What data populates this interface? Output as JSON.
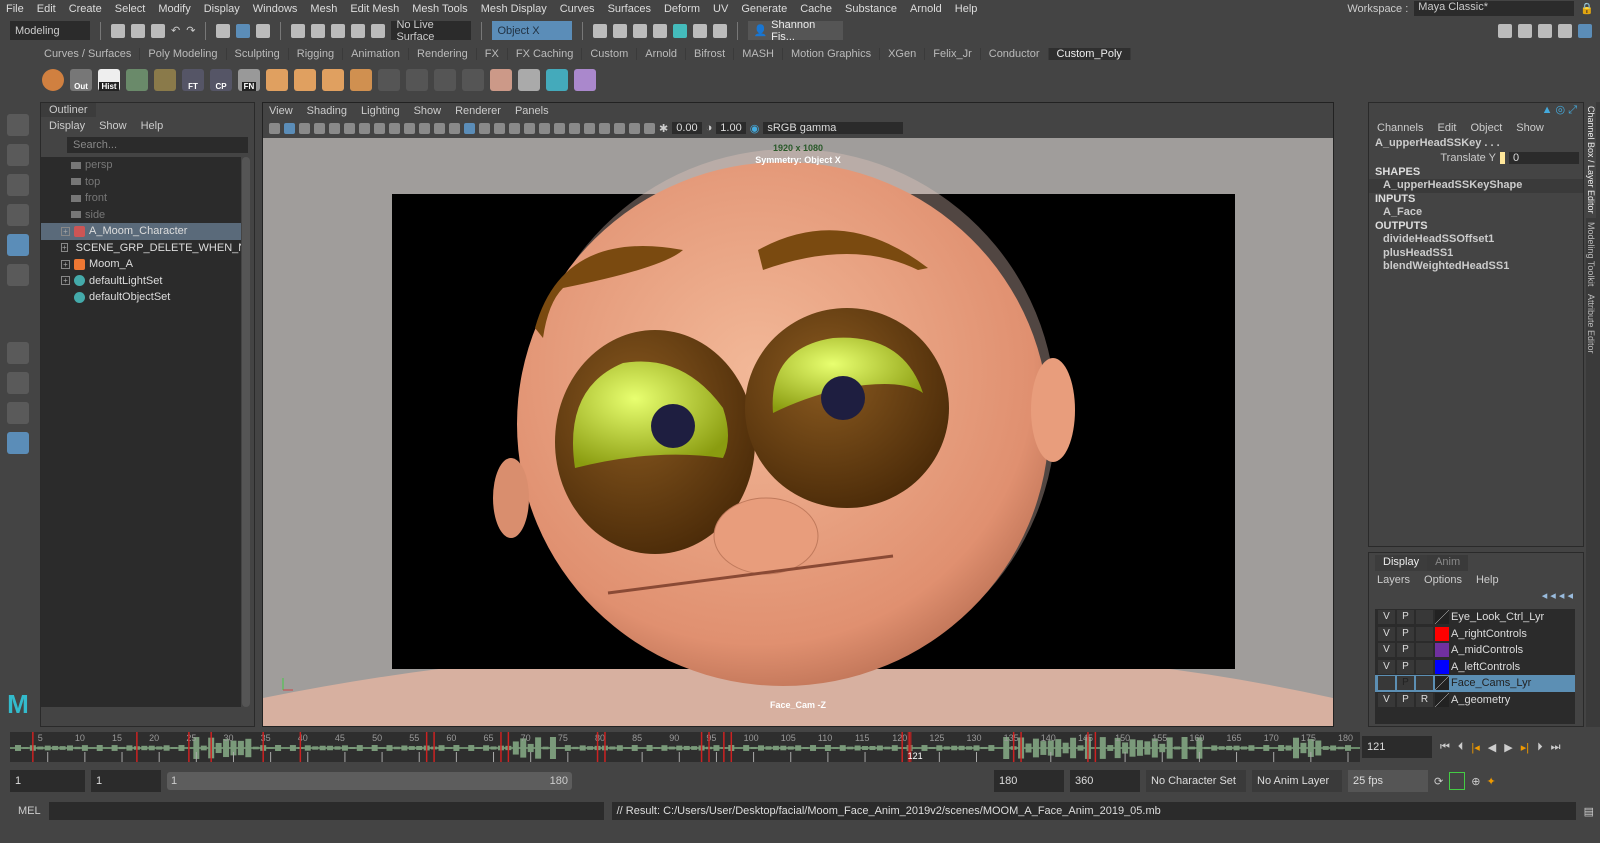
{
  "menu": [
    "File",
    "Edit",
    "Create",
    "Select",
    "Modify",
    "Display",
    "Windows",
    "Mesh",
    "Edit Mesh",
    "Mesh Tools",
    "Mesh Display",
    "Curves",
    "Surfaces",
    "Deform",
    "UV",
    "Generate",
    "Cache",
    "Substance",
    "Arnold",
    "Help"
  ],
  "workspace": {
    "label": "Workspace :",
    "value": "Maya Classic*"
  },
  "status": {
    "mode": "Modeling",
    "live_surface": "No Live Surface",
    "symmetry": "Object X",
    "user": "Shannon Fis..."
  },
  "shelf_tabs": [
    "Curves / Surfaces",
    "Poly Modeling",
    "Sculpting",
    "Rigging",
    "Animation",
    "Rendering",
    "FX",
    "FX Caching",
    "Custom",
    "Arnold",
    "Bifrost",
    "MASH",
    "Motion Graphics",
    "XGen",
    "Felix_Jr",
    "Conductor",
    "Custom_Poly"
  ],
  "shelf_labels": {
    "out": "Out",
    "hist": "Hist",
    "ft": "FT",
    "cp": "CP",
    "fn": "FN"
  },
  "outliner": {
    "title": "Outliner",
    "menu": [
      "Display",
      "Show",
      "Help"
    ],
    "search_placeholder": "Search...",
    "cameras": [
      "persp",
      "top",
      "front",
      "side"
    ],
    "items": [
      "A_Moom_Character",
      "SCENE_GRP_DELETE_WHEN_NECESSA",
      "Moom_A",
      "defaultLightSet",
      "defaultObjectSet"
    ]
  },
  "viewport": {
    "menu": [
      "View",
      "Shading",
      "Lighting",
      "Show",
      "Renderer",
      "Panels"
    ],
    "exposure": "0.00",
    "gamma": "1.00",
    "color_space": "sRGB gamma",
    "resolution": "1920 x 1080",
    "symmetry": "Symmetry: Object X",
    "camera": "Face_Cam -Z"
  },
  "channel_box": {
    "menu": [
      "Channels",
      "Edit",
      "Object",
      "Show"
    ],
    "node": "A_upperHeadSSKey . . .",
    "attr_label": "Translate Y",
    "attr_value": "0",
    "shapes_hdr": "SHAPES",
    "shape": "A_upperHeadSSKeyShape",
    "inputs_hdr": "INPUTS",
    "input": "A_Face",
    "outputs_hdr": "OUTPUTS",
    "outputs": [
      "divideHeadSSOffset1",
      "plusHeadSS1",
      "blendWeightedHeadSS1"
    ]
  },
  "layer_editor": {
    "tabs": [
      "Display",
      "Anim"
    ],
    "menu": [
      "Layers",
      "Options",
      "Help"
    ],
    "layers": [
      {
        "v": "V",
        "p": "P",
        "r": "",
        "name": "Eye_Look_Ctrl_Lyr",
        "color": ""
      },
      {
        "v": "V",
        "p": "P",
        "r": "",
        "name": "A_rightControls",
        "color": "#ff0000"
      },
      {
        "v": "V",
        "p": "P",
        "r": "",
        "name": "A_midControls",
        "color": "#7030a0"
      },
      {
        "v": "V",
        "p": "P",
        "r": "",
        "name": "A_leftControls",
        "color": "#0000ff"
      },
      {
        "v": "",
        "p": "P",
        "r": "",
        "name": "Face_Cams_Lyr",
        "color": ""
      },
      {
        "v": "V",
        "p": "P",
        "r": "R",
        "name": "A_geometry",
        "color": ""
      }
    ]
  },
  "side_tabs": [
    "Channel Box / Layer Editor",
    "Modeling Toolkit",
    "Attribute Editor"
  ],
  "timeline": {
    "start": 1,
    "end": 180,
    "current": 121,
    "current_label": "121",
    "keys": [
      3,
      17,
      24,
      27,
      34,
      39,
      56,
      57,
      66,
      67,
      79,
      80,
      93,
      94,
      96,
      97,
      120,
      121,
      135,
      136,
      145,
      146
    ],
    "labels": [
      "5",
      "10",
      "15",
      "20",
      "25",
      "30",
      "35",
      "40",
      "45",
      "50",
      "55",
      "60",
      "65",
      "70",
      "75",
      "80",
      "85",
      "90",
      "95",
      "100",
      "105",
      "110",
      "115",
      "120",
      "125",
      "130",
      "135",
      "140",
      "145",
      "150",
      "155",
      "160",
      "165",
      "170",
      "175",
      "180"
    ]
  },
  "current_frame_field": "121",
  "range": {
    "start": "1",
    "inner_start": "1",
    "slider_start": "1",
    "slider_end": "180",
    "end": "180",
    "outer_end": "360",
    "char_set": "No Character Set",
    "anim_layer": "No Anim Layer",
    "fps": "25 fps"
  },
  "command": {
    "lang": "MEL",
    "result": "// Result: C:/Users/User/Desktop/facial/Moom_Face_Anim_2019v2/scenes/MOOM_A_Face_Anim_2019_05.mb"
  }
}
